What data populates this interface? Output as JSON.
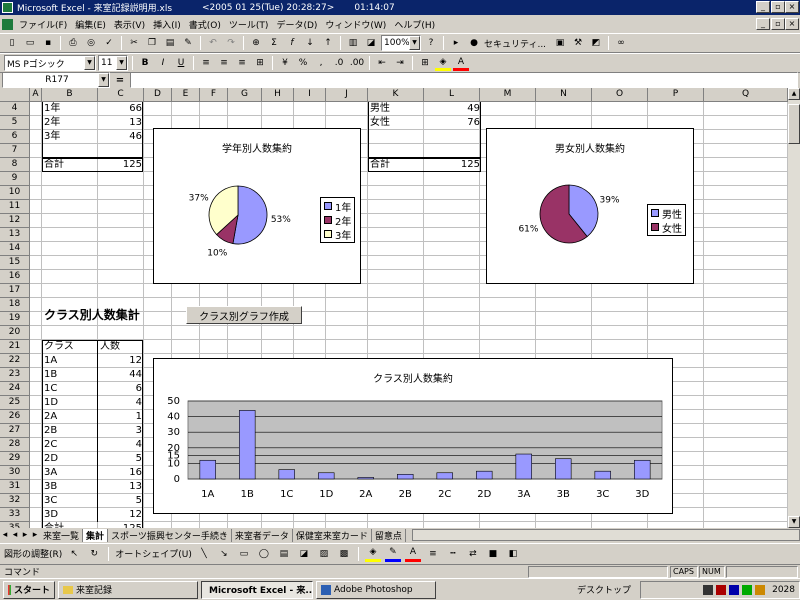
{
  "window": {
    "app_icon": "excel-icon",
    "title": "Microsoft Excel - 来室記録説明用.xls",
    "datetime": "<2005 01 25(Tue) 20:28:27>",
    "clock": "01:14:07"
  },
  "menu": [
    "ファイル(F)",
    "編集(E)",
    "表示(V)",
    "挿入(I)",
    "書式(O)",
    "ツール(T)",
    "データ(D)",
    "ウィンドウ(W)",
    "ヘルプ(H)"
  ],
  "toolbar": {
    "zoom": "100%",
    "security_label": "セキュリティ...",
    "font_name": "MS Pゴシック",
    "font_size": "11"
  },
  "formula_bar": {
    "name_box": "R177",
    "equals": "=",
    "formula": ""
  },
  "columns": [
    "A",
    "B",
    "C",
    "D",
    "E",
    "F",
    "G",
    "H",
    "I",
    "J",
    "K",
    "L",
    "M",
    "N",
    "O",
    "P",
    "Q"
  ],
  "rows": [
    "4",
    "5",
    "6",
    "7",
    "8",
    "9",
    "10",
    "11",
    "12",
    "13",
    "14",
    "15",
    "16",
    "17",
    "18",
    "19",
    "20",
    "21",
    "22",
    "23",
    "24",
    "25",
    "26",
    "27",
    "28",
    "29",
    "30",
    "31",
    "32",
    "33",
    "35"
  ],
  "grade_table": [
    {
      "label": "1年",
      "value": "66"
    },
    {
      "label": "2年",
      "value": "13"
    },
    {
      "label": "3年",
      "value": "46"
    }
  ],
  "grade_total": {
    "label": "合計",
    "value": "125"
  },
  "gender_table": [
    {
      "label": "男性",
      "value": "49"
    },
    {
      "label": "女性",
      "value": "76"
    }
  ],
  "gender_total": {
    "label": "合計",
    "value": "125"
  },
  "class_section": {
    "title": "クラス別人数集計",
    "button_label": "クラス別グラフ作成",
    "header_class": "クラス",
    "header_count": "人数",
    "total_label": "合計",
    "total_value": "125",
    "rows": [
      {
        "cls": "1A",
        "n": "12"
      },
      {
        "cls": "1B",
        "n": "44"
      },
      {
        "cls": "1C",
        "n": "6"
      },
      {
        "cls": "1D",
        "n": "4"
      },
      {
        "cls": "2A",
        "n": "1"
      },
      {
        "cls": "2B",
        "n": "3"
      },
      {
        "cls": "2C",
        "n": "4"
      },
      {
        "cls": "2D",
        "n": "5"
      },
      {
        "cls": "3A",
        "n": "16"
      },
      {
        "cls": "3B",
        "n": "13"
      },
      {
        "cls": "3C",
        "n": "5"
      },
      {
        "cls": "3D",
        "n": "12"
      }
    ]
  },
  "chart_data": [
    {
      "type": "pie",
      "title": "学年別人数集約",
      "categories": [
        "1年",
        "2年",
        "3年"
      ],
      "values": [
        66,
        13,
        46
      ],
      "percent_labels": [
        "53%",
        "10%",
        "37%"
      ],
      "colors": [
        "#9999ff",
        "#993366",
        "#ffffcc"
      ],
      "legend": "right"
    },
    {
      "type": "pie",
      "title": "男女別人数集約",
      "categories": [
        "男性",
        "女性"
      ],
      "values": [
        49,
        76
      ],
      "percent_labels": [
        "39%",
        "61%"
      ],
      "colors": [
        "#9999ff",
        "#993366"
      ],
      "legend": "right"
    },
    {
      "type": "bar",
      "title": "クラス別人数集約",
      "categories": [
        "1A",
        "1B",
        "1C",
        "1D",
        "2A",
        "2B",
        "2C",
        "2D",
        "3A",
        "3B",
        "3C",
        "3D"
      ],
      "values": [
        12,
        44,
        6,
        4,
        1,
        3,
        4,
        5,
        16,
        13,
        5,
        12
      ],
      "ylim": [
        0,
        50
      ],
      "yticks": [
        "0",
        "10",
        "15",
        "20",
        "30",
        "40",
        "50"
      ],
      "grid": true,
      "plot_bg": "#c0c0c0",
      "bar_color": "#9999ff"
    }
  ],
  "sheet_tabs": [
    "来室一覧",
    "集計",
    "スポーツ振興センター手続き",
    "来室者データ",
    "保健室来室カード",
    "留意点"
  ],
  "active_tab": "集計",
  "drawing": {
    "draw_label": "図形の調整(R)",
    "autoshape_label": "オートシェイプ(U)"
  },
  "status": {
    "mode": "コマンド",
    "caps": "CAPS",
    "num": "NUM"
  },
  "taskbar": {
    "start": "スタート",
    "tasks": [
      "来室記録",
      "Microsoft Excel - 来...",
      "Adobe Photoshop"
    ],
    "active_task": 1,
    "desktop": "デスクトップ",
    "time": "2028"
  }
}
